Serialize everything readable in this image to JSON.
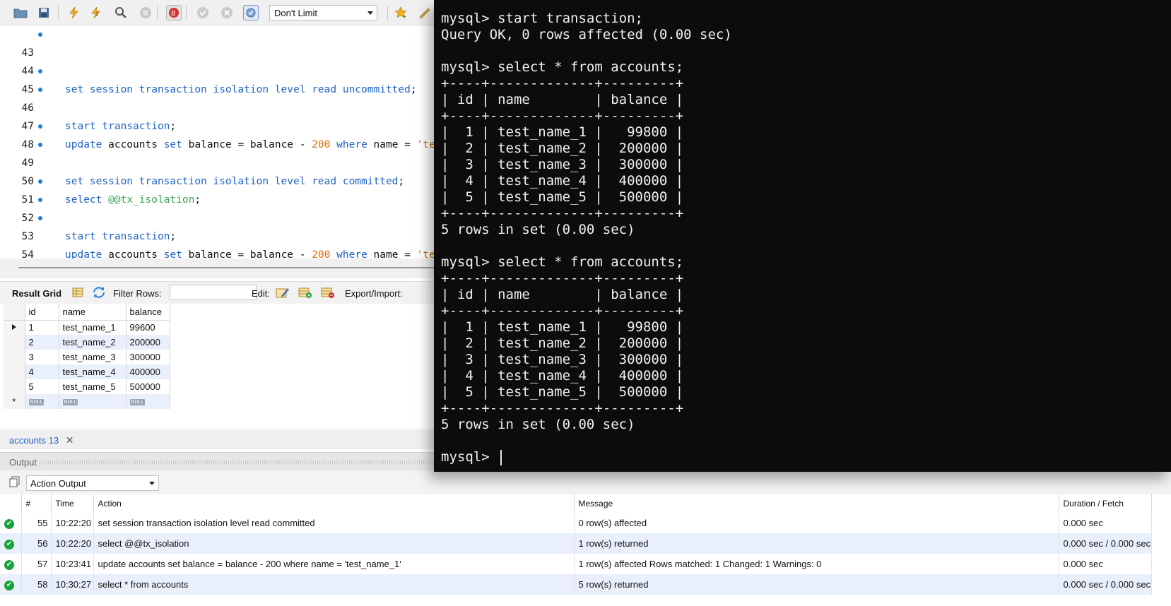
{
  "toolbar": {
    "limit_label": "Don't Limit",
    "icons": [
      "open-folder-icon",
      "save-icon",
      "execute-icon",
      "execute-current-icon",
      "explain-icon",
      "stop-icon",
      "toggle-error-icon",
      "commit-icon",
      "rollback-icon",
      "autocommit-icon",
      "bookmark-icon",
      "beautify-icon"
    ]
  },
  "editor": {
    "lines": [
      {
        "n": "43",
        "dot": true,
        "code": "set session transaction isolation level read uncommitted;"
      },
      {
        "n": "44",
        "dot": false,
        "code": ""
      },
      {
        "n": "45",
        "dot": true,
        "code": "start transaction;"
      },
      {
        "n": "46",
        "dot": true,
        "code": "update accounts set balance = balance - 200 where name = 'te"
      },
      {
        "n": "47",
        "dot": false,
        "code": ""
      },
      {
        "n": "48",
        "dot": true,
        "code": "set session transaction isolation level read committed;"
      },
      {
        "n": "49",
        "dot": true,
        "code": "select @@tx_isolation;"
      },
      {
        "n": "50",
        "dot": false,
        "code": ""
      },
      {
        "n": "51",
        "dot": true,
        "code": "start transaction;"
      },
      {
        "n": "52",
        "dot": true,
        "code": "update accounts set balance = balance - 200 where name = 'te"
      },
      {
        "n": "53",
        "dot": true,
        "code": "select * from accounts;"
      },
      {
        "n": "54",
        "dot": false,
        "code": ""
      }
    ]
  },
  "result_toolbar": {
    "result_grid_label": "Result Grid",
    "filter_label": "Filter Rows:",
    "filter_value": "",
    "edit_label": "Edit:",
    "export_label": "Export/Import:"
  },
  "grid": {
    "columns": [
      "id",
      "name",
      "balance"
    ],
    "rows": [
      [
        "1",
        "test_name_1",
        "99600"
      ],
      [
        "2",
        "test_name_2",
        "200000"
      ],
      [
        "3",
        "test_name_3",
        "300000"
      ],
      [
        "4",
        "test_name_4",
        "400000"
      ],
      [
        "5",
        "test_name_5",
        "500000"
      ]
    ],
    "null_label": "NULL"
  },
  "result_tab": {
    "label": "accounts 13"
  },
  "output": {
    "title": "Output",
    "selector": "Action Output",
    "columns": [
      "",
      "#",
      "Time",
      "Action",
      "Message",
      "Duration / Fetch"
    ],
    "rows": [
      {
        "num": "55",
        "time": "10:22:20",
        "action": "set session transaction isolation level read committed",
        "message": "0 row(s) affected",
        "duration": "0.000 sec"
      },
      {
        "num": "56",
        "time": "10:22:20",
        "action": "select @@tx_isolation",
        "message": "1 row(s) returned",
        "duration": "0.000 sec / 0.000 sec"
      },
      {
        "num": "57",
        "time": "10:23:41",
        "action": "update accounts set balance = balance - 200 where name = 'test_name_1'",
        "message": "1 row(s) affected Rows matched: 1  Changed: 1  Warnings: 0",
        "duration": "0.000 sec"
      },
      {
        "num": "58",
        "time": "10:30:27",
        "action": "select * from accounts",
        "message": "5 row(s) returned",
        "duration": "0.000 sec / 0.000 sec"
      }
    ]
  },
  "terminal": {
    "lines": [
      "mysql> start transaction;",
      "Query OK, 0 rows affected (0.00 sec)",
      "",
      "mysql> select * from accounts;",
      "+----+-------------+---------+",
      "| id | name        | balance |",
      "+----+-------------+---------+",
      "|  1 | test_name_1 |   99800 |",
      "|  2 | test_name_2 |  200000 |",
      "|  3 | test_name_3 |  300000 |",
      "|  4 | test_name_4 |  400000 |",
      "|  5 | test_name_5 |  500000 |",
      "+----+-------------+---------+",
      "5 rows in set (0.00 sec)",
      "",
      "mysql> select * from accounts;",
      "+----+-------------+---------+",
      "| id | name        | balance |",
      "+----+-------------+---------+",
      "|  1 | test_name_1 |   99800 |",
      "|  2 | test_name_2 |  200000 |",
      "|  3 | test_name_3 |  300000 |",
      "|  4 | test_name_4 |  400000 |",
      "|  5 | test_name_5 |  500000 |",
      "+----+-------------+---------+",
      "5 rows in set (0.00 sec)",
      "",
      "mysql> "
    ]
  }
}
